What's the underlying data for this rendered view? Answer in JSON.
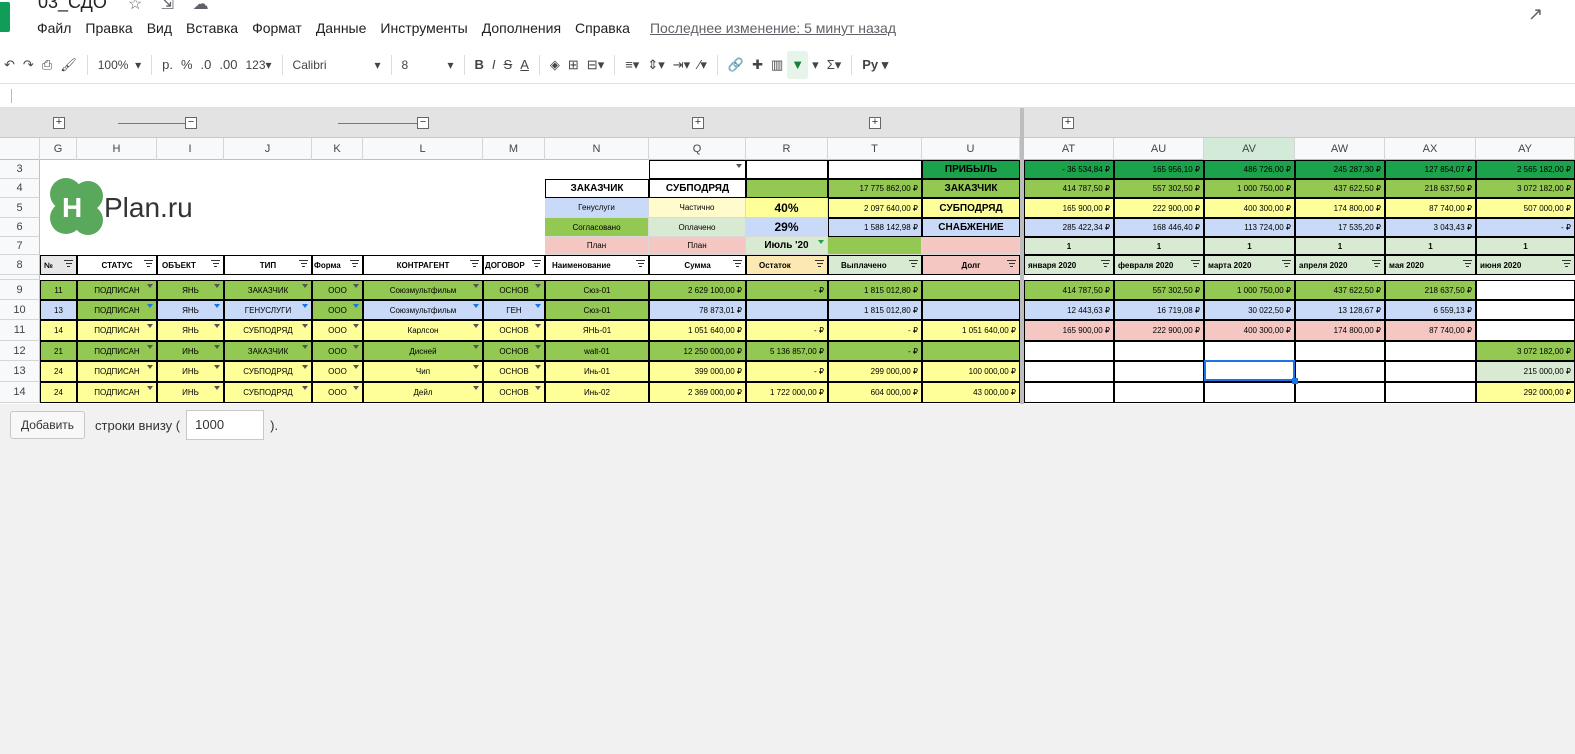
{
  "doc": {
    "title": "03_СДО"
  },
  "menu": [
    "Файл",
    "Правка",
    "Вид",
    "Вставка",
    "Формат",
    "Данные",
    "Инструменты",
    "Дополнения",
    "Справка"
  ],
  "last_edit": "Последнее изменение: 5 минут назад",
  "toolbar": {
    "zoom": "100%",
    "currency": "р.",
    "percent": "%",
    "dec_less": ".0",
    "dec_more": ".00",
    "format_more": "123",
    "font": "Calibri",
    "font_size": "8"
  },
  "col_headers": [
    "G",
    "H",
    "I",
    "J",
    "K",
    "L",
    "M",
    "N",
    "Q",
    "R",
    "T",
    "U",
    "AT",
    "AU",
    "AV",
    "AW",
    "AX",
    "AY"
  ],
  "row_headers": [
    "3",
    "4",
    "5",
    "6",
    "7",
    "8",
    "9",
    "10",
    "11",
    "12",
    "13",
    "14"
  ],
  "logo": {
    "h": "H",
    "text": "Plan.ru"
  },
  "top": {
    "zakazchik": "ЗАКАЗЧИК",
    "subpodryad": "СУБПОДРЯД",
    "genuslugi": "Генуслуги",
    "chastichno": "Частично",
    "pct40": "40%",
    "soglasovano": "Согласовано",
    "oplacheno": "Оплачено",
    "pct29": "29%",
    "plan_n": "План",
    "plan_q": "План",
    "month": "Июль '20",
    "t4": "17 775 862,00 ₽",
    "t5": "2 097 640,00 ₽",
    "t6": "1 588 142,98 ₽",
    "u3": "ПРИБЫЛЬ",
    "u4": "ЗАКАЗЧИК",
    "u5": "СУБПОДРЯД",
    "u6": "СНАБЖЕНИЕ"
  },
  "headers8": [
    "№",
    "СТАТУС",
    "ОБЪЕКТ",
    "ТИП",
    "Форма",
    "КОНТРАГЕНТ",
    "ДОГОВОР",
    "Наименование",
    "Сумма",
    "Остаток",
    "Выплачено",
    "Долг",
    "января 2020",
    "февраля 2020",
    "марта 2020",
    "апреля 2020",
    "мая 2020",
    "июня 2020"
  ],
  "right_top": {
    "r3": [
      "-     36 534,84 ₽",
      "165 956,10 ₽",
      "486 726,00 ₽",
      "245 287,30 ₽",
      "127 854,07 ₽",
      "2 565 182,00 ₽"
    ],
    "r4": [
      "414 787,50 ₽",
      "557 302,50 ₽",
      "1 000 750,00 ₽",
      "437 622,50 ₽",
      "218 637,50 ₽",
      "3 072 182,00 ₽"
    ],
    "r5": [
      "165 900,00 ₽",
      "222 900,00 ₽",
      "400 300,00 ₽",
      "174 800,00 ₽",
      "87 740,00 ₽",
      "507 000,00 ₽"
    ],
    "r6": [
      "285 422,34 ₽",
      "168 446,40 ₽",
      "113 724,00 ₽",
      "17 535,20 ₽",
      "3 043,43 ₽",
      "-     ₽"
    ],
    "r7": [
      "1",
      "1",
      "1",
      "1",
      "1",
      "1"
    ]
  },
  "rows": [
    {
      "n": "11",
      "status": "ПОДПИСАН",
      "obj": "ЯНЬ",
      "type": "ЗАКАЗЧИК",
      "form": "ООО",
      "ka": "Союзмультфильм",
      "dog": "ОСНОВ",
      "name": "Сюз-01",
      "sum": "2 629 100,00 ₽",
      "ost": "-     ₽",
      "vypl": "1 815 012,80 ₽",
      "dolg": "",
      "m": [
        "414 787,50 ₽",
        "557 302,50 ₽",
        "1 000 750,00 ₽",
        "437 622,50 ₽",
        "218 637,50 ₽",
        ""
      ]
    },
    {
      "n": "13",
      "status": "ПОДПИСАН",
      "obj": "ЯНЬ",
      "type": "ГЕНУСЛУГИ",
      "form": "ООО",
      "ka": "Союзмультфильм",
      "dog": "ГЕН",
      "name": "Сюз-01",
      "sum": "78 873,01 ₽",
      "ost": "",
      "vypl": "1 815 012,80 ₽",
      "dolg": "",
      "m": [
        "12 443,63 ₽",
        "16 719,08 ₽",
        "30 022,50 ₽",
        "13 128,67 ₽",
        "6 559,13 ₽",
        ""
      ]
    },
    {
      "n": "14",
      "status": "ПОДПИСАН",
      "obj": "ЯНЬ",
      "type": "СУБПОДРЯД",
      "form": "ООО",
      "ka": "Карлсон",
      "dog": "ОСНОВ",
      "name": "ЯНЬ-01",
      "sum": "1 051 640,00 ₽",
      "ost": "-     ₽",
      "vypl": "-     ₽",
      "dolg": "1 051 640,00 ₽",
      "m": [
        "165 900,00 ₽",
        "222 900,00 ₽",
        "400 300,00 ₽",
        "174 800,00 ₽",
        "87 740,00 ₽",
        ""
      ]
    },
    {
      "n": "21",
      "status": "ПОДПИСАН",
      "obj": "ИНЬ",
      "type": "ЗАКАЗЧИК",
      "form": "ООО",
      "ka": "Дисней",
      "dog": "ОСНОВ",
      "name": "walt-01",
      "sum": "12 250 000,00 ₽",
      "ost": "5 136 857,00 ₽",
      "vypl": "-     ₽",
      "dolg": "",
      "m": [
        "",
        "",
        "",
        "",
        "",
        "3 072 182,00 ₽"
      ]
    },
    {
      "n": "24",
      "status": "ПОДПИСАН",
      "obj": "ИНЬ",
      "type": "СУБПОДРЯД",
      "form": "ООО",
      "ka": "Чип",
      "dog": "ОСНОВ",
      "name": "Инь-01",
      "sum": "399 000,00 ₽",
      "ost": "-     ₽",
      "vypl": "299 000,00 ₽",
      "dolg": "100 000,00 ₽",
      "m": [
        "",
        "",
        "",
        "",
        "",
        "215 000,00 ₽"
      ]
    },
    {
      "n": "24",
      "status": "ПОДПИСАН",
      "obj": "ИНЬ",
      "type": "СУБПОДРЯД",
      "form": "ООО",
      "ka": "Дейл",
      "dog": "ОСНОВ",
      "name": "Инь-02",
      "sum": "2 369 000,00 ₽",
      "ost": "1 722 000,00 ₽",
      "vypl": "604 000,00 ₽",
      "dolg": "43 000,00 ₽",
      "m": [
        "",
        "",
        "",
        "",
        "",
        "292 000,00 ₽"
      ]
    }
  ],
  "bottom": {
    "add_label": "Добавить",
    "rows_label": "строки внизу (",
    "rows_value": "1000",
    "close": ")."
  }
}
